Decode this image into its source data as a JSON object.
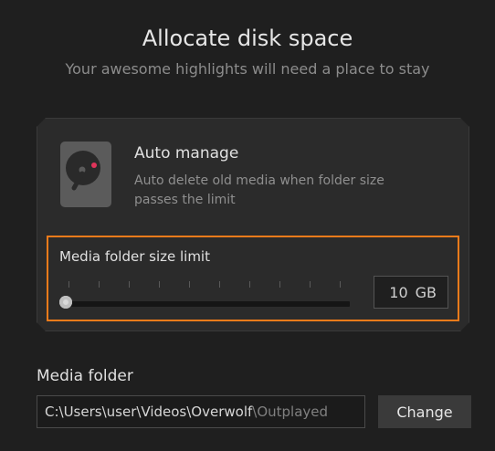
{
  "header": {
    "title": "Allocate disk space",
    "subtitle": "Your awesome highlights will need a place to stay"
  },
  "auto_manage": {
    "title": "Auto manage",
    "description": "Auto delete old media when folder size passes the limit",
    "icon": "hard-disk-icon",
    "accent_color": "#e0345a"
  },
  "size_limit": {
    "label": "Media folder size limit",
    "value": "10",
    "unit": "GB",
    "slider_fraction": 0,
    "highlight_color": "#f07b1a"
  },
  "media_folder": {
    "label": "Media folder",
    "path_main": "C:\\Users\\user\\Videos\\Overwolf",
    "path_dim": "\\Outplayed",
    "change_label": "Change"
  }
}
